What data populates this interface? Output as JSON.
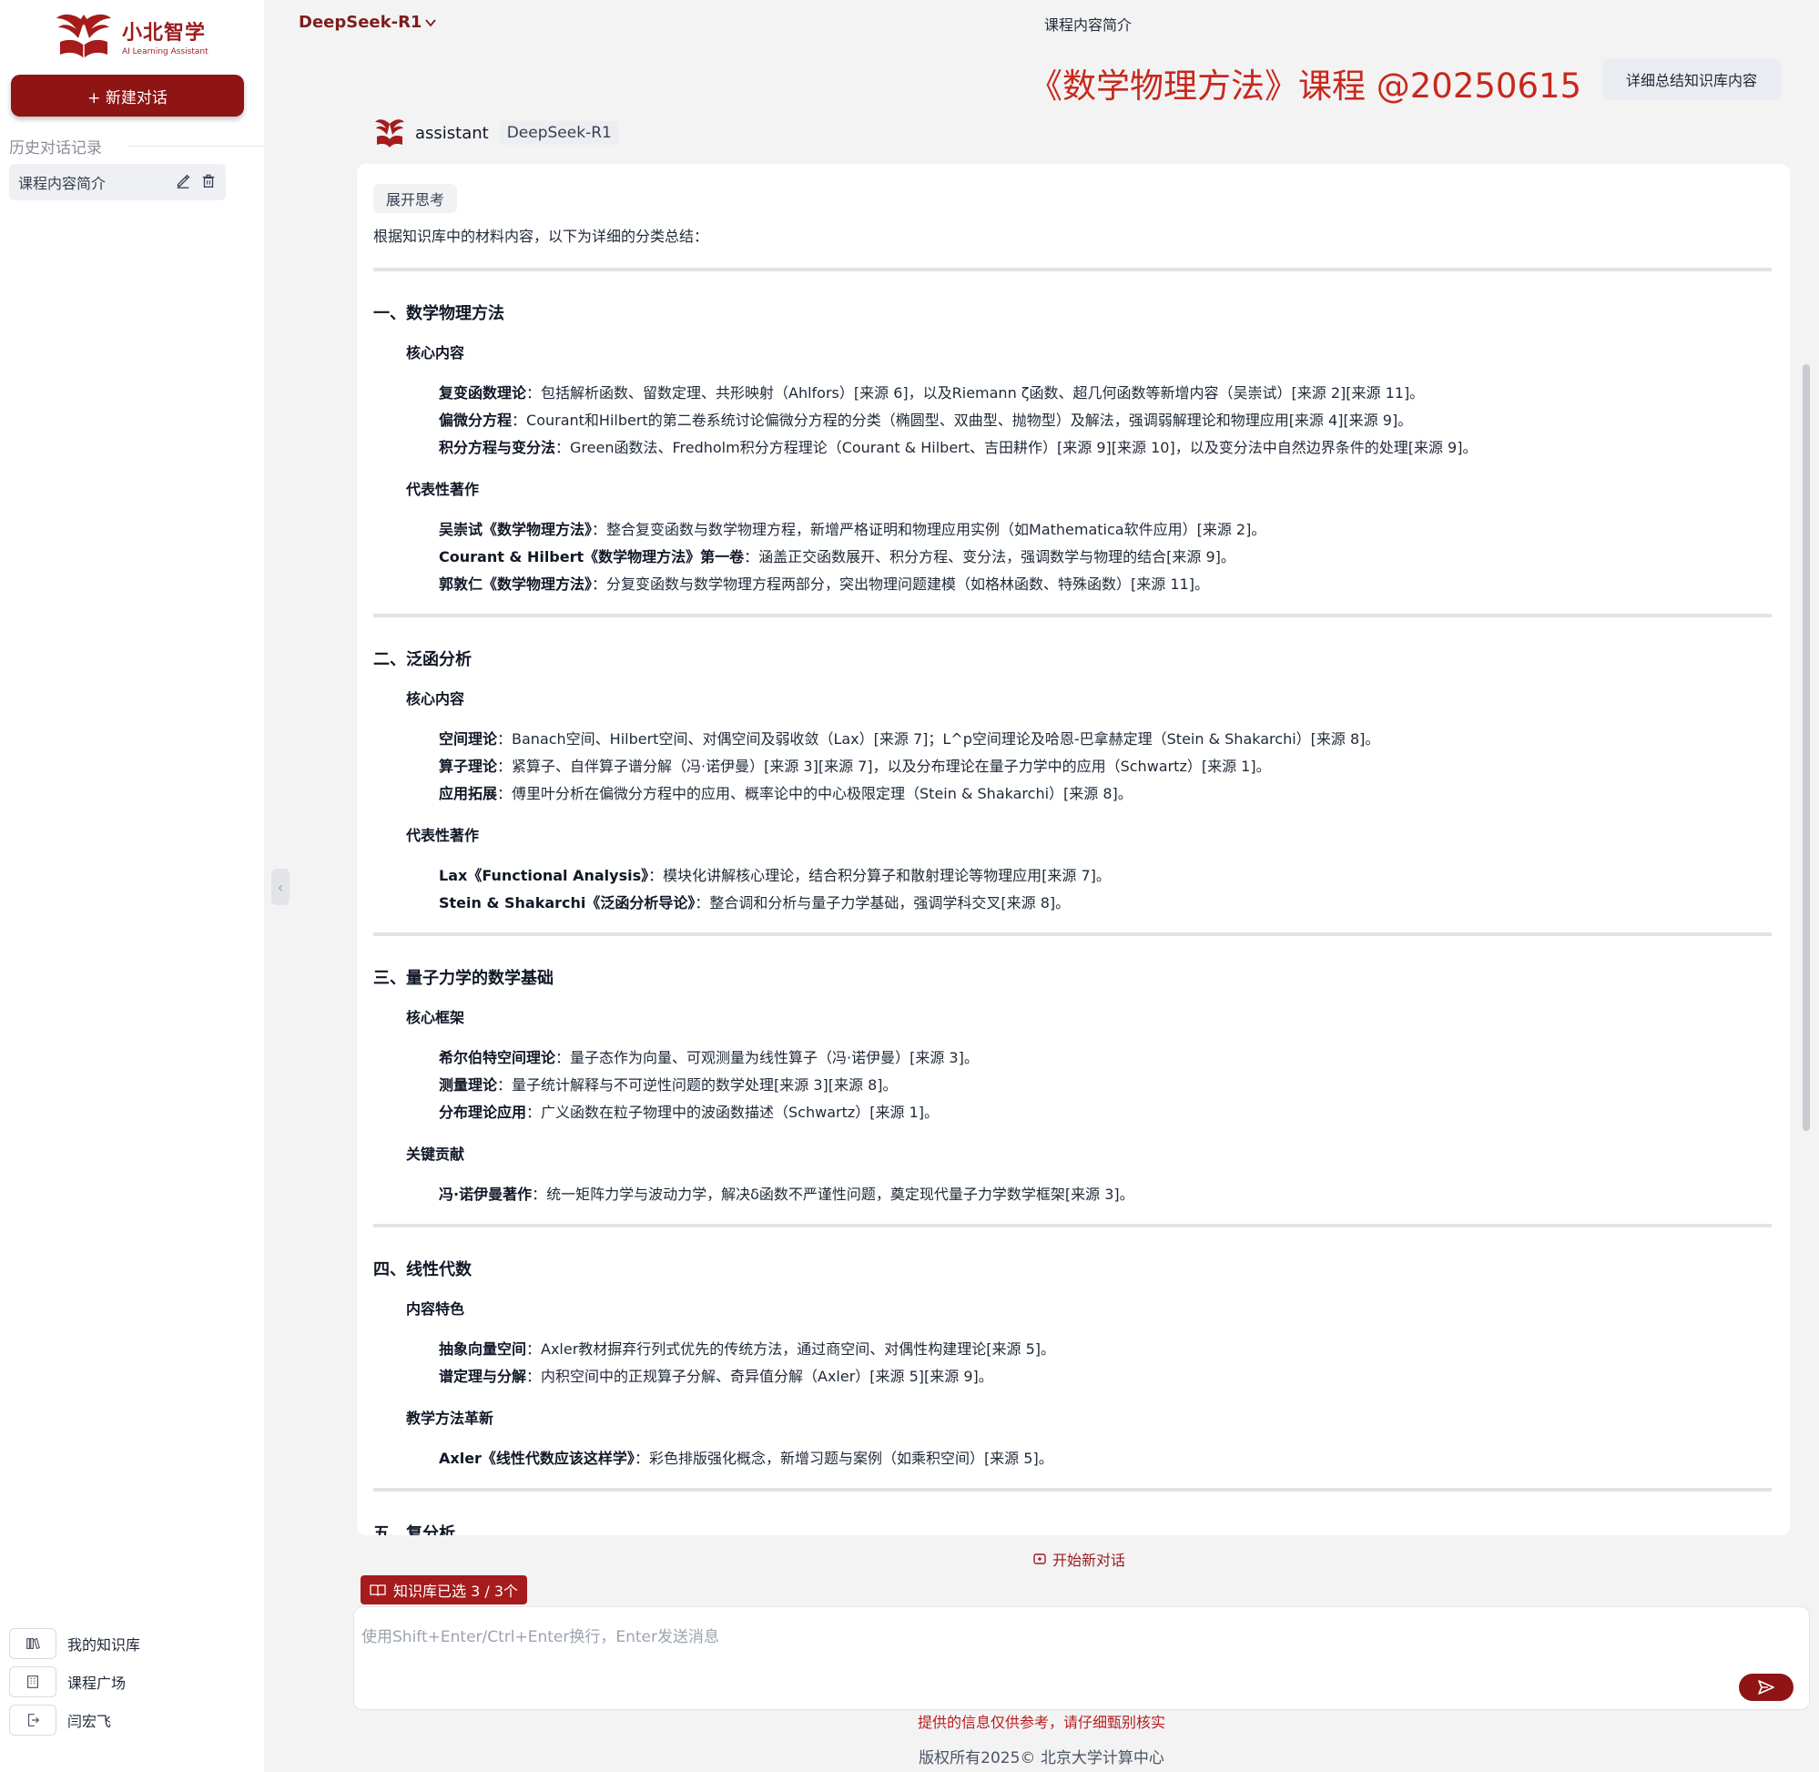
{
  "sidebar": {
    "logo_title": "小北智学",
    "logo_subtitle": "AI Learning Assistant",
    "new_chat_label": "+ 新建对话",
    "history_label": "历史对话记录",
    "history_items": [
      {
        "label": "课程内容简介"
      }
    ],
    "bottom_items": [
      {
        "label": "我的知识库",
        "icon": "library-icon"
      },
      {
        "label": "课程广场",
        "icon": "building-icon"
      },
      {
        "label": "闫宏飞",
        "icon": "logout-icon"
      }
    ]
  },
  "header": {
    "model": "DeepSeek-R1",
    "page_title": "课程内容简介",
    "course_title": "《数学物理方法》课程 @20250615",
    "summary_button": "详细总结知识库内容"
  },
  "message": {
    "role": "assistant",
    "model": "DeepSeek-R1",
    "think_toggle": "展开思考",
    "intro": "根据知识库中的材料内容，以下为详细的分类总结：",
    "sections": [
      {
        "title": "一、数学物理方法",
        "groups": [
          {
            "heading": "核心内容",
            "items": [
              {
                "term": "复变函数理论",
                "text": "：包括解析函数、留数定理、共形映射（Ahlfors）[来源 6]，以及Riemann ζ函数、超几何函数等新增内容（吴崇试）[来源 2][来源 11]。"
              },
              {
                "term": "偏微分方程",
                "text": "：Courant和Hilbert的第二卷系统讨论偏微分方程的分类（椭圆型、双曲型、抛物型）及解法，强调弱解理论和物理应用[来源 4][来源 9]。"
              },
              {
                "term": "积分方程与变分法",
                "text": "：Green函数法、Fredholm积分方程理论（Courant & Hilbert、吉田耕作）[来源 9][来源 10]，以及变分法中自然边界条件的处理[来源 9]。"
              }
            ]
          },
          {
            "heading": "代表性著作",
            "items": [
              {
                "term": "吴崇试《数学物理方法》",
                "text": "：整合复变函数与数学物理方程，新增严格证明和物理应用实例（如Mathematica软件应用）[来源 2]。"
              },
              {
                "term": "Courant & Hilbert《数学物理方法》第一卷",
                "text": "：涵盖正交函数展开、积分方程、变分法，强调数学与物理的结合[来源 9]。"
              },
              {
                "term": "郭敦仁《数学物理方法》",
                "text": "：分复变函数与数学物理方程两部分，突出物理问题建模（如格林函数、特殊函数）[来源 11]。"
              }
            ]
          }
        ]
      },
      {
        "title": "二、泛函分析",
        "groups": [
          {
            "heading": "核心内容",
            "items": [
              {
                "term": "空间理论",
                "text": "：Banach空间、Hilbert空间、对偶空间及弱收敛（Lax）[来源 7]；L^p空间理论及哈恩-巴拿赫定理（Stein & Shakarchi）[来源 8]。"
              },
              {
                "term": "算子理论",
                "text": "：紧算子、自伴算子谱分解（冯·诺伊曼）[来源 3][来源 7]，以及分布理论在量子力学中的应用（Schwartz）[来源 1]。"
              },
              {
                "term": "应用拓展",
                "text": "：傅里叶分析在偏微分方程中的应用、概率论中的中心极限定理（Stein & Shakarchi）[来源 8]。"
              }
            ]
          },
          {
            "heading": "代表性著作",
            "items": [
              {
                "term": "Lax《Functional Analysis》",
                "text": "：模块化讲解核心理论，结合积分算子和散射理论等物理应用[来源 7]。"
              },
              {
                "term": "Stein & Shakarchi《泛函分析导论》",
                "text": "：整合调和分析与量子力学基础，强调学科交叉[来源 8]。"
              }
            ]
          }
        ]
      },
      {
        "title": "三、量子力学的数学基础",
        "groups": [
          {
            "heading": "核心框架",
            "items": [
              {
                "term": "希尔伯特空间理论",
                "text": "：量子态作为向量、可观测量为线性算子（冯·诺伊曼）[来源 3]。"
              },
              {
                "term": "测量理论",
                "text": "：量子统计解释与不可逆性问题的数学处理[来源 3][来源 8]。"
              },
              {
                "term": "分布理论应用",
                "text": "：广义函数在粒子物理中的波函数描述（Schwartz）[来源 1]。"
              }
            ]
          },
          {
            "heading": "关键贡献",
            "items": [
              {
                "term": "冯·诺伊曼著作",
                "text": "：统一矩阵力学与波动力学，解决δ函数不严谨性问题，奠定现代量子力学数学框架[来源 3]。"
              }
            ]
          }
        ]
      },
      {
        "title": "四、线性代数",
        "groups": [
          {
            "heading": "内容特色",
            "items": [
              {
                "term": "抽象向量空间",
                "text": "：Axler教材摒弃行列式优先的传统方法，通过商空间、对偶性构建理论[来源 5]。"
              },
              {
                "term": "谱定理与分解",
                "text": "：内积空间中的正规算子分解、奇异值分解（Axler）[来源 5][来源 9]。"
              }
            ]
          },
          {
            "heading": "教学方法革新",
            "items": [
              {
                "term": "Axler《线性代数应该这样学》",
                "text": "：彩色排版强化概念，新增习题与案例（如乘积空间）[来源 5]。"
              }
            ]
          }
        ]
      },
      {
        "title": "五、复分析",
        "groups": []
      }
    ]
  },
  "footer": {
    "new_conversation": "开始新对话",
    "kb_chip": "知识库已选 3 / 3个",
    "input_placeholder": "使用Shift+Enter/Ctrl+Enter换行，Enter发送消息",
    "disclaimer": "提供的信息仅供参考，请仔细甄别核实",
    "copyright": "版权所有2025© 北京大学计算中心"
  },
  "colors": {
    "brand": "#8f1414",
    "title_red": "#c8281c"
  }
}
